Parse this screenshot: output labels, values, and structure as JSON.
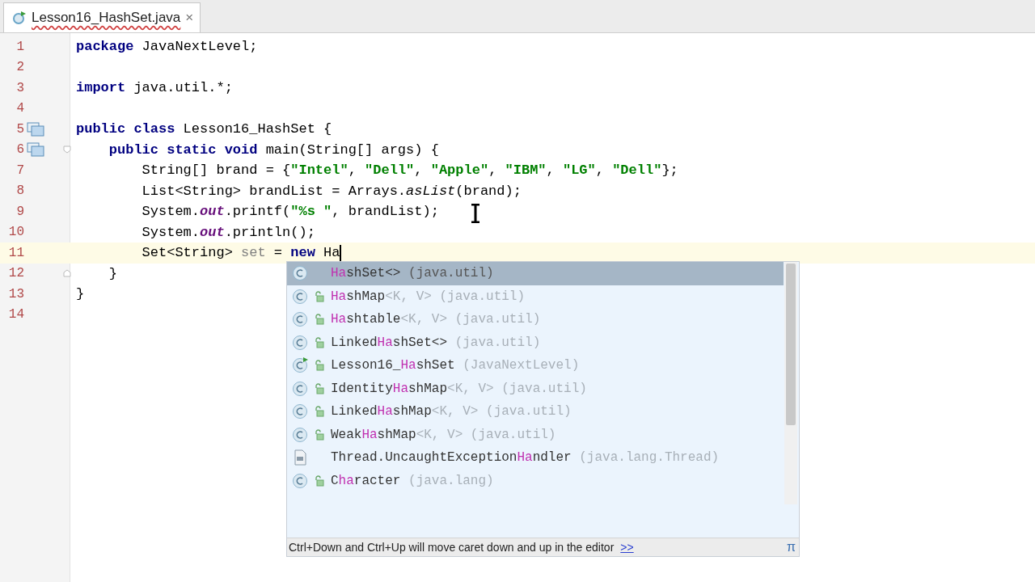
{
  "tab": {
    "title": "Lesson16_HashSet.java",
    "close": "×"
  },
  "editor": {
    "lines": [
      {
        "number": "1",
        "tokens": [
          {
            "kind": "keyword",
            "text": "package"
          },
          {
            "kind": "plain",
            "text": " JavaNextLevel;"
          }
        ]
      },
      {
        "number": "2"
      },
      {
        "number": "3",
        "tokens": [
          {
            "kind": "keyword",
            "text": "import"
          },
          {
            "kind": "plain",
            "text": " java.util.*;"
          }
        ]
      },
      {
        "number": "4"
      },
      {
        "number": "5",
        "gutter_icon": true,
        "tokens": [
          {
            "kind": "keyword",
            "text": "public class"
          },
          {
            "kind": "plain",
            "text": " Lesson16_HashSet {"
          }
        ]
      },
      {
        "number": "6",
        "gutter_icon": true,
        "fold_open": true,
        "tokens": [
          {
            "kind": "keyword",
            "text": "    public static void"
          },
          {
            "kind": "plain",
            "text": " main(String[] args) {"
          }
        ]
      },
      {
        "number": "7",
        "tokens": [
          {
            "kind": "plain",
            "text": "        String[] brand = {"
          },
          {
            "kind": "string",
            "text": "\"Intel\""
          },
          {
            "kind": "plain",
            "text": ", "
          },
          {
            "kind": "string",
            "text": "\"Dell\""
          },
          {
            "kind": "plain",
            "text": ", "
          },
          {
            "kind": "string",
            "text": "\"Apple\""
          },
          {
            "kind": "plain",
            "text": ", "
          },
          {
            "kind": "string",
            "text": "\"IBM\""
          },
          {
            "kind": "plain",
            "text": ", "
          },
          {
            "kind": "string",
            "text": "\"LG\""
          },
          {
            "kind": "plain",
            "text": ", "
          },
          {
            "kind": "string",
            "text": "\"Dell\""
          },
          {
            "kind": "plain",
            "text": "};"
          }
        ]
      },
      {
        "number": "8",
        "tokens": [
          {
            "kind": "plain",
            "text": "        List<String> brandList = Arrays."
          },
          {
            "kind": "static",
            "text": "asList"
          },
          {
            "kind": "plain",
            "text": "(brand);"
          }
        ]
      },
      {
        "number": "9",
        "tokens": [
          {
            "kind": "plain",
            "text": "        System."
          },
          {
            "kind": "field",
            "text": "out"
          },
          {
            "kind": "plain",
            "text": ".printf("
          },
          {
            "kind": "string",
            "text": "\"%s \""
          },
          {
            "kind": "plain",
            "text": ", brandList);"
          }
        ]
      },
      {
        "number": "10",
        "tokens": [
          {
            "kind": "plain",
            "text": "        System."
          },
          {
            "kind": "field",
            "text": "out"
          },
          {
            "kind": "plain",
            "text": ".println();"
          }
        ]
      },
      {
        "number": "11",
        "current": true,
        "caret": true,
        "tokens": [
          {
            "kind": "plain",
            "text": "        Set<String> "
          },
          {
            "kind": "unused",
            "text": "set"
          },
          {
            "kind": "plain",
            "text": " = "
          },
          {
            "kind": "keyword",
            "text": "new"
          },
          {
            "kind": "plain",
            "text": " Ha"
          }
        ]
      },
      {
        "number": "12",
        "fold_close": true,
        "tokens": [
          {
            "kind": "plain",
            "text": "    }"
          }
        ]
      },
      {
        "number": "13",
        "tokens": [
          {
            "kind": "plain",
            "text": "}"
          }
        ]
      },
      {
        "number": "14"
      }
    ]
  },
  "completion": {
    "items": [
      {
        "kind": "class",
        "public": false,
        "selected": true,
        "name": [
          {
            "text": "Ha",
            "match": true
          },
          {
            "text": "shSet<>",
            "match": false
          }
        ],
        "package": "(java.util)"
      },
      {
        "kind": "class",
        "public": true,
        "selected": false,
        "name": [
          {
            "text": "Ha",
            "match": true
          },
          {
            "text": "shMap",
            "match": false
          }
        ],
        "type_params": "<K, V>",
        "package": "(java.util)"
      },
      {
        "kind": "class",
        "public": true,
        "selected": false,
        "name": [
          {
            "text": "Ha",
            "match": true
          },
          {
            "text": "shtable",
            "match": false
          }
        ],
        "type_params": "<K, V>",
        "package": "(java.util)"
      },
      {
        "kind": "class",
        "public": true,
        "selected": false,
        "name": [
          {
            "text": "Linked",
            "match": false
          },
          {
            "text": "Ha",
            "match": true
          },
          {
            "text": "shSet<>",
            "match": false
          }
        ],
        "package": "(java.util)"
      },
      {
        "kind": "runnable",
        "public": true,
        "selected": false,
        "name": [
          {
            "text": "Lesson16_",
            "match": false
          },
          {
            "text": "Ha",
            "match": true
          },
          {
            "text": "shSet",
            "match": false
          }
        ],
        "package": "(JavaNextLevel)"
      },
      {
        "kind": "class",
        "public": true,
        "selected": false,
        "name": [
          {
            "text": "Identity",
            "match": false
          },
          {
            "text": "Ha",
            "match": true
          },
          {
            "text": "shMap",
            "match": false
          }
        ],
        "type_params": "<K, V>",
        "package": "(java.util)"
      },
      {
        "kind": "class",
        "public": true,
        "selected": false,
        "name": [
          {
            "text": "Linked",
            "match": false
          },
          {
            "text": "Ha",
            "match": true
          },
          {
            "text": "shMap",
            "match": false
          }
        ],
        "type_params": "<K, V>",
        "package": "(java.util)"
      },
      {
        "kind": "class",
        "public": true,
        "selected": false,
        "name": [
          {
            "text": "Weak",
            "match": false
          },
          {
            "text": "Ha",
            "match": true
          },
          {
            "text": "shMap",
            "match": false
          }
        ],
        "type_params": "<K, V>",
        "package": "(java.util)"
      },
      {
        "kind": "file",
        "public": false,
        "selected": false,
        "name": [
          {
            "text": "Thread.UncaughtException",
            "match": false
          },
          {
            "text": "Ha",
            "match": true
          },
          {
            "text": "ndler",
            "match": false
          }
        ],
        "package": "(java.lang.Thread)"
      },
      {
        "kind": "class",
        "public": true,
        "selected": false,
        "name": [
          {
            "text": "C",
            "match": false
          },
          {
            "text": "ha",
            "match": true
          },
          {
            "text": "racter",
            "match": false
          }
        ],
        "package": "(java.lang)"
      }
    ],
    "hint": "Ctrl+Down and Ctrl+Up will move caret down and up in the editor",
    "hint_link": ">>",
    "corner": "π"
  }
}
